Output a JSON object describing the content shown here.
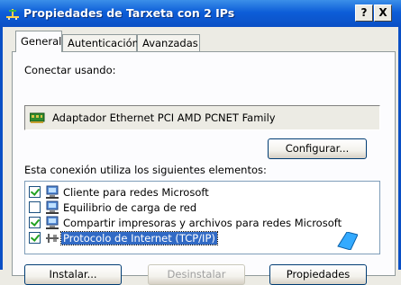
{
  "window": {
    "title": "Propiedades de Tarxeta con 2 IPs",
    "help_label": "?",
    "close_label": "X",
    "title_icon": "network-connection-icon"
  },
  "tabs": [
    {
      "label": "General",
      "active": true
    },
    {
      "label": "Autenticación",
      "active": false
    },
    {
      "label": "Avanzadas",
      "active": false
    }
  ],
  "connect": {
    "label": "Conectar usando:",
    "adapter_name": "Adaptador Ethernet PCI AMD PCNET Family",
    "adapter_icon": "network-card-icon",
    "configure_label": "Configurar..."
  },
  "components": {
    "label": "Esta conexión utiliza los siguientes elementos:",
    "items": [
      {
        "label": "Cliente para redes Microsoft",
        "checked": true,
        "icon": "computer-network-icon",
        "selected": false
      },
      {
        "label": "Equilibrio de carga de red",
        "checked": false,
        "icon": "computer-network-icon",
        "selected": false
      },
      {
        "label": "Compartir impresoras y archivos para redes Microsoft",
        "checked": true,
        "icon": "computer-network-icon",
        "selected": false
      },
      {
        "label": "Protocolo de Internet (TCP/IP)",
        "checked": true,
        "icon": "protocol-icon",
        "selected": true
      }
    ]
  },
  "buttons": {
    "install_label": "Instalar...",
    "uninstall_label": "Desinstalar",
    "properties_label": "Propiedades"
  },
  "colors": {
    "titlebar": "#0a4fc5",
    "selection": "#316ac5",
    "cursor": "#33aaff"
  }
}
